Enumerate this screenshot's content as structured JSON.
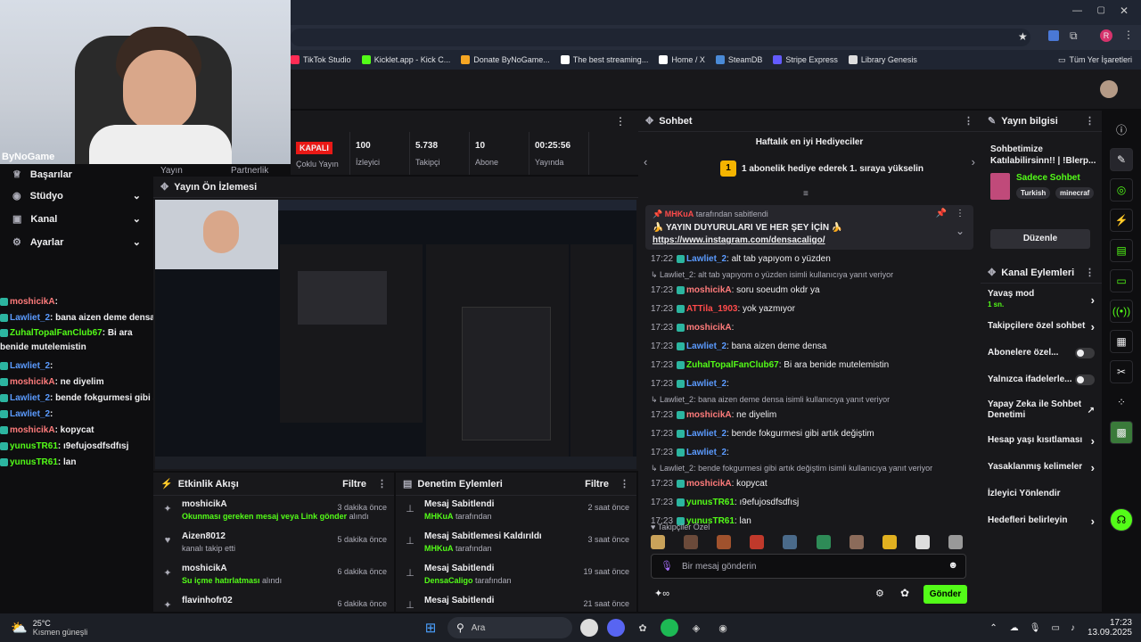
{
  "browser": {
    "bookmarks": [
      {
        "label": "TikTok Studio",
        "color": "#fe2c55"
      },
      {
        "label": "Kicklet.app - Kick C...",
        "color": "#53fc18"
      },
      {
        "label": "Donate ByNoGame...",
        "color": "#f5a623"
      },
      {
        "label": "The best streaming...",
        "color": "#ffffff"
      },
      {
        "label": "Home / X",
        "color": "#ffffff"
      },
      {
        "label": "SteamDB",
        "color": "#4a8ad6"
      },
      {
        "label": "Stripe Express",
        "color": "#635bff"
      },
      {
        "label": "Library Genesis",
        "color": "#dddddd"
      }
    ],
    "all_bookmarks": "Tüm Yer İşaretleri",
    "profile_initial": "R"
  },
  "webcam": {
    "overlay_text": "ByNoGame"
  },
  "stats": [
    {
      "value": "KAPALI",
      "label": "Çoklu Yayın"
    },
    {
      "value": "100",
      "label": "İzleyici"
    },
    {
      "value": "5.738",
      "label": "Takipçi"
    },
    {
      "value": "10",
      "label": "Abone"
    },
    {
      "value": "00:25:56",
      "label": "Yayında"
    }
  ],
  "stats_partial_labels": [
    "Yayın",
    "Partnerlik"
  ],
  "leftnav": {
    "items": [
      {
        "label": "Başarılar"
      },
      {
        "label": "Stüdyo"
      },
      {
        "label": "Kanal"
      },
      {
        "label": "Ayarlar"
      }
    ]
  },
  "left_chat": [
    {
      "user": "moshicikA",
      "text": ": ",
      "color": "#ff7b7b"
    },
    {
      "user": "Lawliet_2",
      "text": ": bana aizen deme densa",
      "color": "#5b9bff"
    },
    {
      "user": "ZuhalTopalFanClub67",
      "text": ": Bi ara benide mutelemistin",
      "color": "#53fc18"
    },
    {
      "user": "Lawliet_2",
      "text": ": ",
      "color": "#5b9bff"
    },
    {
      "user": "moshicikA",
      "text": ": ne diyelim",
      "color": "#ff7b7b"
    },
    {
      "user": "Lawliet_2",
      "text": ": bende fokgurmesi gibi artık değiştim",
      "color": "#5b9bff"
    },
    {
      "user": "Lawliet_2",
      "text": ": ",
      "color": "#5b9bff"
    },
    {
      "user": "moshicikA",
      "text": ": kopycat",
      "color": "#ff7b7b"
    },
    {
      "user": "yunusTR61",
      "text": ": ı9efujosdfsdfısj",
      "color": "#53fc18"
    },
    {
      "user": "yunusTR61",
      "text": ": lan",
      "color": "#53fc18"
    }
  ],
  "preview": {
    "title": "Yayın Ön İzlemesi"
  },
  "activity": {
    "title": "Etkinlik Akışı",
    "filter": "Filtre",
    "items": [
      {
        "name": "moshicikA",
        "detail": "Okunması gereken mesaj veya Link gönder",
        "suffix": " alındı",
        "time": "3 dakika önce",
        "icon": "redeem-icon"
      },
      {
        "name": "Aizen8012",
        "detail": "",
        "suffix": "kanalı takip etti",
        "time": "5 dakika önce",
        "icon": "heart-icon"
      },
      {
        "name": "moshicikA",
        "detail": "Su içme hatırlatması",
        "suffix": " alındı",
        "time": "6 dakika önce",
        "icon": "redeem-icon"
      },
      {
        "name": "flavinhofr02",
        "detail": "",
        "suffix": "",
        "time": "6 dakika önce",
        "icon": "redeem-icon"
      }
    ]
  },
  "moderation": {
    "title": "Denetim Eylemleri",
    "filter": "Filtre",
    "items": [
      {
        "name": "Mesaj Sabitlendi",
        "by": "MHKuA",
        "suffix": " tarafından",
        "time": "2 saat önce"
      },
      {
        "name": "Mesaj Sabitlemesi Kaldırıldı",
        "by": "MHKuA",
        "suffix": " tarafından",
        "time": "3 saat önce"
      },
      {
        "name": "Mesaj Sabitlendi",
        "by": "DensaCaligo",
        "suffix": " tarafından",
        "time": "19 saat önce"
      },
      {
        "name": "Mesaj Sabitlendi",
        "by": "",
        "suffix": "",
        "time": "21 saat önce"
      }
    ]
  },
  "chat": {
    "title": "Sohbet",
    "gifters_title": "Haftalık en iyi Hediyeciler",
    "gifters_rank": "1",
    "gifters_text": "1 abonelik hediye ederek 1. sıraya yükselin",
    "pinned_by": "MHKuA",
    "pinned_suffix": " tarafından sabitlendi",
    "pinned_text": "🍌 YAYIN DUYURULARI VE HER ŞEY İÇİN 🍌",
    "pinned_link": "https://www.instagram.com/densacaligo/",
    "messages": [
      {
        "type": "msg",
        "time": "17:22",
        "user": "Lawliet_2",
        "color": "#5b9bff",
        "text": ": alt tab yapıyom o yüzden"
      },
      {
        "type": "reply",
        "text": "↳ Lawliet_2: alt tab yapıyom o yüzden isimli kullanıcıya yanıt veriyor"
      },
      {
        "type": "msg",
        "time": "17:23",
        "user": "moshicikA",
        "color": "#ff7b7b",
        "text": ": soru soeudm okdr ya"
      },
      {
        "type": "msg",
        "time": "17:23",
        "user": "ATTila_1903",
        "color": "#ff4b4b",
        "text": ": yok yazmıyor"
      },
      {
        "type": "msg",
        "time": "17:23",
        "user": "moshicikA",
        "color": "#ff7b7b",
        "text": ": "
      },
      {
        "type": "msg",
        "time": "17:23",
        "user": "Lawliet_2",
        "color": "#5b9bff",
        "text": ": bana aizen deme densa"
      },
      {
        "type": "msg",
        "time": "17:23",
        "user": "ZuhalTopalFanClub67",
        "color": "#53fc18",
        "text": ": Bi ara benide mutelemistin"
      },
      {
        "type": "msg",
        "time": "17:23",
        "user": "Lawliet_2",
        "color": "#5b9bff",
        "text": ": "
      },
      {
        "type": "reply",
        "text": "↳ Lawliet_2: bana aizen deme densa isimli kullanıcıya yanıt veriyor"
      },
      {
        "type": "msg",
        "time": "17:23",
        "user": "moshicikA",
        "color": "#ff7b7b",
        "text": ": ne diyelim"
      },
      {
        "type": "msg",
        "time": "17:23",
        "user": "Lawliet_2",
        "color": "#5b9bff",
        "text": ": bende fokgurmesi gibi artık değiştim"
      },
      {
        "type": "msg",
        "time": "17:23",
        "user": "Lawliet_2",
        "color": "#5b9bff",
        "text": ": "
      },
      {
        "type": "reply",
        "text": "↳ Lawliet_2: bende fokgurmesi gibi artık değiştim isimli kullanıcıya yanıt veriyor"
      },
      {
        "type": "msg",
        "time": "17:23",
        "user": "moshicikA",
        "color": "#ff7b7b",
        "text": ": kopycat"
      },
      {
        "type": "msg",
        "time": "17:23",
        "user": "yunusTR61",
        "color": "#53fc18",
        "text": ": ı9efujosdfsdfısj"
      },
      {
        "type": "msg",
        "time": "17:23",
        "user": "yunusTR61",
        "color": "#53fc18",
        "text": ": lan"
      }
    ],
    "followers_title": "Takipçiler Özel",
    "input_placeholder": "Bir mesaj gönderin",
    "send_label": "Gönder"
  },
  "stream_info": {
    "title": "Yayın bilgisi",
    "stream_title": "Sohbetimize Katılabilirsinn!! | !Blerp...",
    "category": "Sadece Sohbet",
    "tags": [
      "Turkish",
      "minecraf"
    ],
    "edit_label": "Düzenle"
  },
  "channel_actions": {
    "title": "Kanal Eylemleri",
    "items": [
      {
        "label": "Yavaş mod",
        "sub": "1 sn.",
        "control": "chevron"
      },
      {
        "label": "Takipçilere özel sohbet",
        "sub": "",
        "control": "chevron"
      },
      {
        "label": "Abonelere özel...",
        "sub": "",
        "control": "toggle"
      },
      {
        "label": "Yalnızca ifadelerle...",
        "sub": "",
        "control": "toggle"
      },
      {
        "label": "Yapay Zeka ile Sohbet Denetimi",
        "sub": "",
        "control": "external"
      },
      {
        "label": "Hesap yaşı kısıtlaması",
        "sub": "",
        "control": "chevron"
      },
      {
        "label": "Yasaklanmış kelimeler",
        "sub": "",
        "control": "chevron"
      },
      {
        "label": "İzleyici Yönlendir",
        "sub": "",
        "control": "none"
      },
      {
        "label": "Hedefleri belirleyin",
        "sub": "",
        "control": "chevron"
      }
    ]
  },
  "taskbar": {
    "weather_temp": "25°C",
    "weather_desc": "Kısmen güneşli",
    "search_label": "Ara",
    "time": "17:23",
    "date": "13.09.2025"
  },
  "colors": {
    "accent": "#53fc18",
    "panel": "#18181b",
    "bg": "#0e0e10",
    "live": "#e91916"
  }
}
